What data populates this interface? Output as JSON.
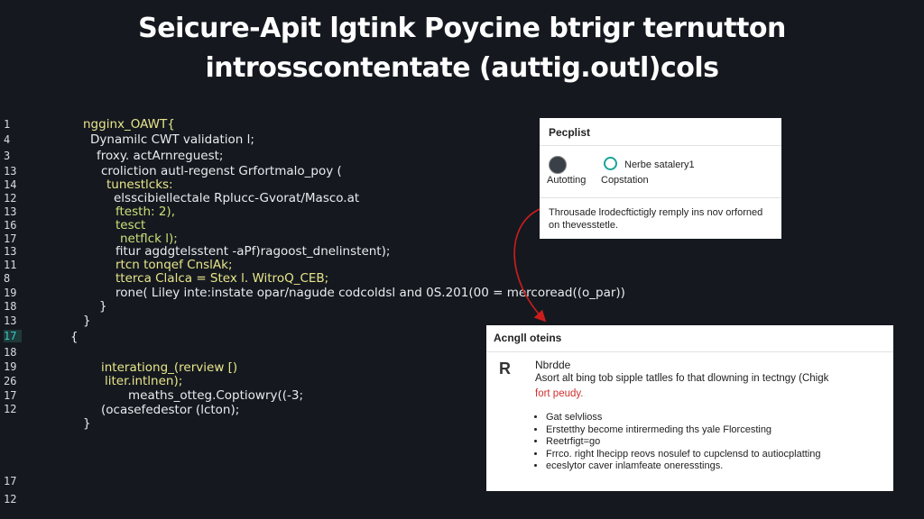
{
  "title": {
    "line1": "Seicure-Apit lgtink Poycine btrigr ternutton",
    "line2": "introsscontentate (auttig.outl)cols"
  },
  "gutter": [
    "1",
    "4",
    "3",
    "13",
    "14",
    "12",
    "13",
    "16",
    "17",
    "13",
    "11",
    "8",
    "19",
    "18",
    "13",
    "17",
    "18",
    "19",
    "26",
    "17",
    "12"
  ],
  "code_lines": [
    "ngginx_OAWT{",
    "Dynamilc CWT validation l;",
    "froxy. actArnreguest;",
    "croliction autl-regenst Grfortmalo_poy (",
    "tunestlcks:",
    "elsscibiellectale Rplucc-Gvorat/Masco.at",
    "ftesth: 2),",
    "tesct",
    "netflck l);",
    "fitur agdgtelsstent -aPf)ragoost_dnelinstent);",
    "rtcn tonqef CnslAk;",
    "tterca Clalca = Stex l. WitroQ_CEB;",
    "rone( Liley inte:instate opar/nagude codcoldsl and 0S.201(00 = mercoread((o_par))",
    "}",
    "}",
    "{",
    "interationg_(rerview [)",
    "liter.intlnen);",
    "meaths_otteg.Coptiowry((-3;",
    "(ocasefedestor (lcton);",
    "}"
  ],
  "people_panel": {
    "heading": "Pecplist",
    "item1_label": "Autotting",
    "item2_title": "Nerbe satalery1",
    "item2_label": "Copstation",
    "description": "Throusade lrodecftictigly remply ins nov orforned on thevesstetle."
  },
  "analysis_panel": {
    "heading": "Acngll oteins",
    "badge": "R",
    "subheading": "Nbrdde",
    "body": "Asort alt bing tob sipple tatlles fo that dlowning in tectngy (Chigk",
    "warning": "fort peudy.",
    "bullets": [
      "Gat selvlioss",
      "Erstetthy become intirermeding ths yale Florcesting",
      "Reetrfigt=go",
      "Frrco. right lhecipp reovs nosulef to cupclensd to autiocplatting",
      "eceslytor caver inlamfeate oneresstings."
    ]
  },
  "colors": {
    "background": "#15191f",
    "arrow": "#cc1d1d",
    "accent_teal": "#1aa39a"
  }
}
